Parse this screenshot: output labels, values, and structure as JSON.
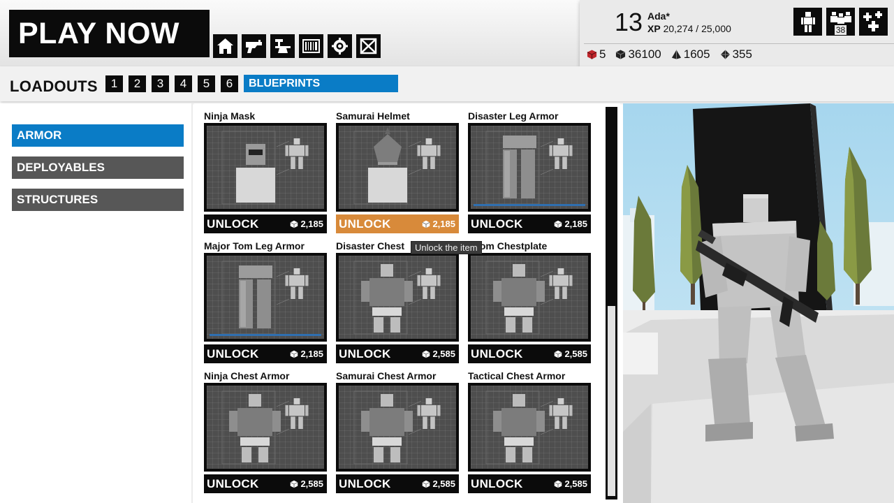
{
  "header": {
    "play_now": "PLAY NOW",
    "nav_icons": [
      "home-icon",
      "weapons-icon",
      "crafting-anvil-icon",
      "barcode-icon",
      "settings-gear-icon",
      "crate-icon"
    ]
  },
  "profile": {
    "level": "13",
    "name": "Ada*",
    "xp_label": "XP",
    "xp_value": "20,274 / 25,000",
    "icons": [
      {
        "name": "character-icon"
      },
      {
        "name": "squad-icon",
        "count": "38"
      },
      {
        "name": "add-stats-icon"
      }
    ],
    "currencies": [
      {
        "icon": "red-cube-icon",
        "value": "5",
        "color": "#c0262c"
      },
      {
        "icon": "block-icon",
        "value": "36100",
        "color": "#222222"
      },
      {
        "icon": "pyramid-icon",
        "value": "1605",
        "color": "#222222"
      },
      {
        "icon": "diamond-icon",
        "value": "355",
        "color": "#222222"
      }
    ]
  },
  "loadouts": {
    "label": "LOADOUTS",
    "slots": [
      "1",
      "2",
      "3",
      "4",
      "5",
      "6"
    ],
    "blueprints": "BLUEPRINTS"
  },
  "categories": [
    {
      "label": "ARMOR",
      "active": true
    },
    {
      "label": "DEPLOYABLES",
      "active": false
    },
    {
      "label": "STRUCTURES",
      "active": false
    }
  ],
  "items": [
    {
      "name": "Ninja Mask",
      "action": "UNLOCK",
      "price": "2,185",
      "kind": "head"
    },
    {
      "name": "Samurai Helmet",
      "action": "UNLOCK",
      "price": "2,185",
      "kind": "helmet",
      "hover": true
    },
    {
      "name": "Disaster Leg Armor",
      "action": "UNLOCK",
      "price": "2,185",
      "kind": "legs"
    },
    {
      "name": "Major Tom Leg Armor",
      "action": "UNLOCK",
      "price": "2,185",
      "kind": "legs"
    },
    {
      "name": "Disaster Chest",
      "action": "UNLOCK",
      "price": "2,585",
      "kind": "chest"
    },
    {
      "name": "r Tom Chestplate",
      "action": "UNLOCK",
      "price": "2,585",
      "kind": "chest"
    },
    {
      "name": "Ninja Chest Armor",
      "action": "UNLOCK",
      "price": "2,585",
      "kind": "chest"
    },
    {
      "name": "Samurai Chest Armor",
      "action": "UNLOCK",
      "price": "2,585",
      "kind": "chest"
    },
    {
      "name": "Tactical Chest Armor",
      "action": "UNLOCK",
      "price": "2,585",
      "kind": "chest"
    }
  ],
  "tooltip": "Unlock the item",
  "colors": {
    "accent_blue": "#0a7cc6",
    "hover_orange": "#d88a3a",
    "black": "#0b0b0b"
  }
}
